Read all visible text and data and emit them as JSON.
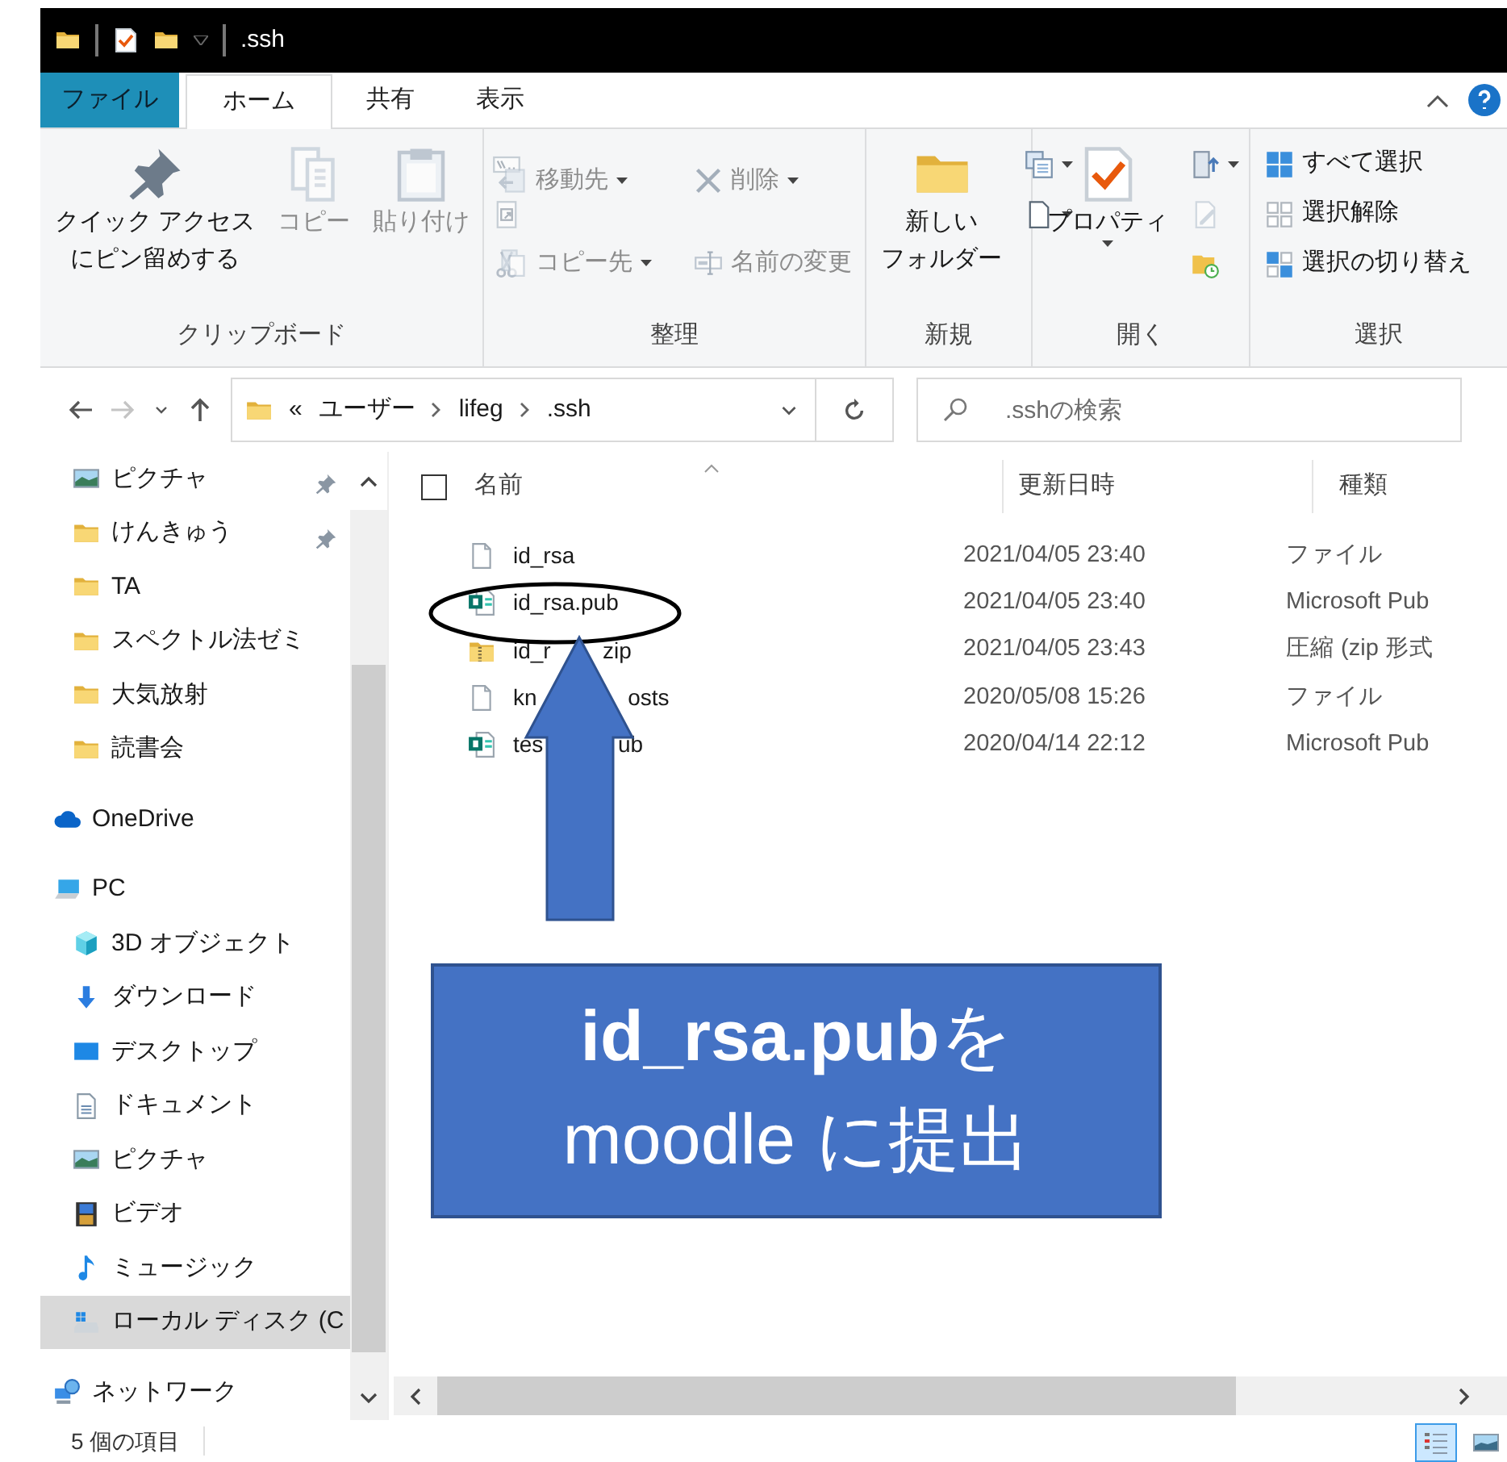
{
  "title_bar": {
    "title": ".ssh"
  },
  "tabs": [
    {
      "label": "ファイル",
      "kind": "file",
      "selected": false
    },
    {
      "label": "ホーム",
      "kind": "tab",
      "selected": true
    },
    {
      "label": "共有",
      "kind": "tab",
      "selected": false
    },
    {
      "label": "表示",
      "kind": "tab",
      "selected": false
    }
  ],
  "ribbon": {
    "groups": [
      {
        "label": "クリップボード",
        "columns": [
          [
            {
              "kind": "large",
              "lines": [
                "クイック アクセス",
                "にピン留めする"
              ],
              "dropdown": false,
              "disabled": false
            }
          ],
          [
            {
              "kind": "large",
              "label": "コピー",
              "dropdown": false,
              "disabled": true
            }
          ],
          [
            {
              "kind": "large",
              "label": "貼り付け",
              "dropdown": false,
              "disabled": true
            }
          ],
          [
            {
              "kind": "small",
              "dropdown": false,
              "disabled": true
            },
            {
              "kind": "small",
              "dropdown": false,
              "disabled": true
            },
            {
              "kind": "small",
              "dropdown": false,
              "disabled": true
            }
          ]
        ]
      },
      {
        "label": "整理",
        "columns": [
          [
            {
              "kind": "small",
              "label": "移動先",
              "dropdown": true,
              "disabled": true
            },
            {
              "kind": "small",
              "label": "コピー先",
              "dropdown": true,
              "disabled": true
            }
          ],
          [
            {
              "kind": "small",
              "label": "削除",
              "dropdown": true,
              "disabled": true
            },
            {
              "kind": "small",
              "label": "名前の変更",
              "dropdown": false,
              "disabled": true
            }
          ]
        ]
      },
      {
        "label": "新規",
        "columns": [
          [
            {
              "kind": "large",
              "lines": [
                "新しい",
                "フォルダー"
              ],
              "dropdown": false,
              "disabled": false
            }
          ],
          [
            {
              "kind": "small",
              "dropdown": true,
              "disabled": false
            },
            {
              "kind": "small",
              "dropdown": true,
              "disabled": false
            }
          ]
        ]
      },
      {
        "label": "開く",
        "columns": [
          [
            {
              "kind": "large",
              "label": "プロパティ",
              "dropdown": true,
              "disabled": false
            }
          ],
          [
            {
              "kind": "small",
              "dropdown": true,
              "disabled": false
            },
            {
              "kind": "small",
              "dropdown": false,
              "disabled": true
            },
            {
              "kind": "small",
              "dropdown": false,
              "disabled": false
            }
          ]
        ]
      },
      {
        "label": "選択",
        "columns": [
          [
            {
              "kind": "small",
              "label": "すべて選択",
              "dropdown": false,
              "disabled": false
            },
            {
              "kind": "small",
              "label": "選択解除",
              "dropdown": false,
              "disabled": false
            },
            {
              "kind": "small",
              "label": "選択の切り替え",
              "dropdown": false,
              "disabled": false
            }
          ]
        ]
      }
    ]
  },
  "navigation": [
    {
      "kind": "back",
      "disabled": false
    },
    {
      "kind": "forward",
      "disabled": true
    },
    {
      "kind": "recent",
      "disabled": false
    },
    {
      "kind": "up",
      "disabled": false
    }
  ],
  "address": {
    "overflow": "«",
    "crumbs": [
      "ユーザー",
      "lifeg",
      ".ssh"
    ]
  },
  "search": {
    "placeholder": ".sshの検索"
  },
  "sidebar": {
    "quick_access": [
      {
        "label": "ピクチャ",
        "kind": "picture",
        "pinned": true,
        "selected": false
      },
      {
        "label": "けんきゅう",
        "kind": "folder",
        "pinned": true,
        "selected": false
      },
      {
        "label": "TA",
        "kind": "folder",
        "pinned": false,
        "selected": false
      },
      {
        "label": "スペクトル法ゼミ",
        "kind": "folder",
        "pinned": false,
        "selected": false
      },
      {
        "label": "大気放射",
        "kind": "folder",
        "pinned": false,
        "selected": false
      },
      {
        "label": "読書会",
        "kind": "folder",
        "pinned": false,
        "selected": false
      }
    ],
    "tree": [
      {
        "label": "OneDrive",
        "kind": "cloud",
        "selected": false
      },
      {
        "label": "PC",
        "kind": "pc",
        "selected": false,
        "children": [
          {
            "label": "3D オブジェクト",
            "kind": "cube",
            "selected": false
          },
          {
            "label": "ダウンロード",
            "kind": "download",
            "selected": false
          },
          {
            "label": "デスクトップ",
            "kind": "desktop",
            "selected": false
          },
          {
            "label": "ドキュメント",
            "kind": "document",
            "selected": false
          },
          {
            "label": "ピクチャ",
            "kind": "picture",
            "selected": false
          },
          {
            "label": "ビデオ",
            "kind": "video",
            "selected": false
          },
          {
            "label": "ミュージック",
            "kind": "music",
            "selected": false
          },
          {
            "label": "ローカル ディスク (C",
            "kind": "drive",
            "selected": true
          }
        ]
      },
      {
        "label": "ネットワーク",
        "kind": "network",
        "selected": false
      }
    ]
  },
  "file_list": {
    "select_all": {
      "checked": false
    },
    "columns": [
      {
        "label": "名前",
        "sorted": true
      },
      {
        "label": "更新日時",
        "sorted": false
      },
      {
        "label": "種類",
        "sorted": false
      }
    ],
    "rows": [
      {
        "kind": "file",
        "name": "id_rsa",
        "date": "2021/04/05 23:40",
        "type": "ファイル"
      },
      {
        "kind": "publisher",
        "name": "id_rsa.pub",
        "date": "2021/04/05 23:40",
        "type": "Microsoft Pub"
      },
      {
        "kind": "zip",
        "name": "id_r",
        "name_tail": "zip",
        "date": "2021/04/05 23:43",
        "type": "圧縮 (zip 形式"
      },
      {
        "kind": "file",
        "name": "kn",
        "name_tail": "osts",
        "date": "2020/05/08 15:26",
        "type": "ファイル"
      },
      {
        "kind": "publisher",
        "name": "tes",
        "name_tail": "ub",
        "date": "2020/04/14 22:12",
        "type": "Microsoft Pub"
      }
    ]
  },
  "status_bar": {
    "item_count": "5 個の項目",
    "views": [
      {
        "kind": "details",
        "selected": true
      },
      {
        "kind": "large-icons",
        "selected": false
      }
    ]
  },
  "annotation": {
    "callout": "**id_rsa.pub**を\nmoodle に提出"
  }
}
